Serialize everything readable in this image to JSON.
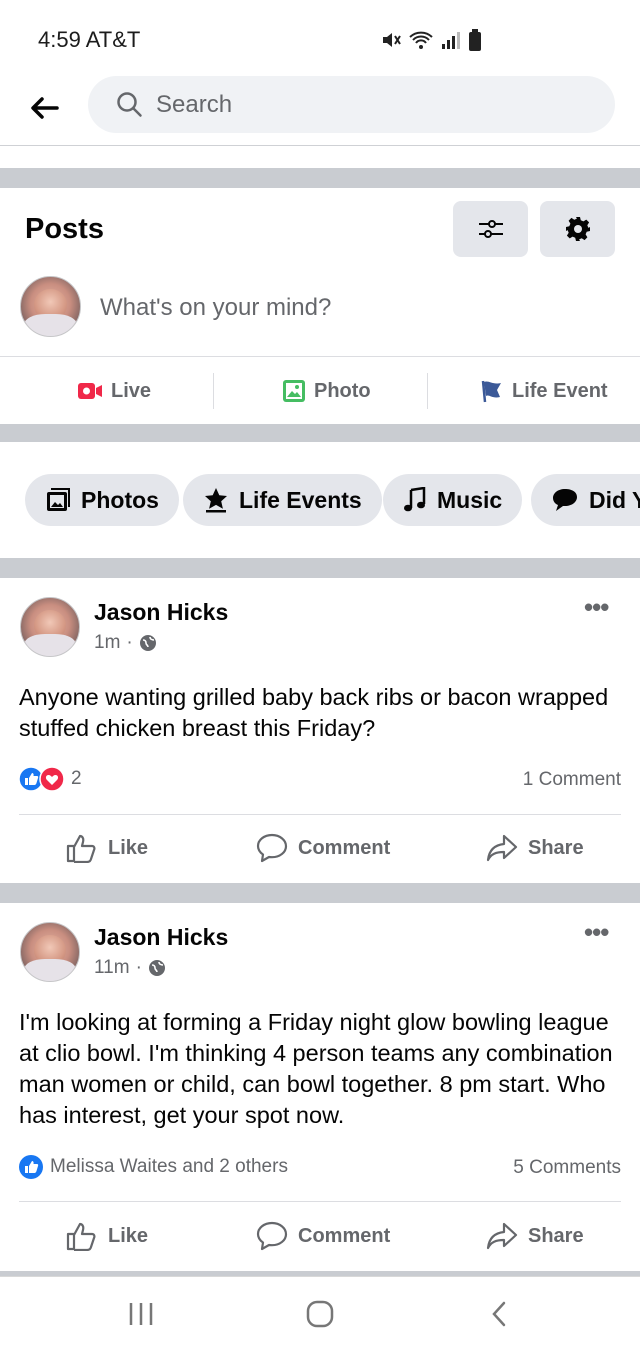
{
  "status": {
    "time": "4:59",
    "carrier": "AT&T"
  },
  "search": {
    "placeholder": "Search"
  },
  "header": {
    "title": "Posts",
    "composer_placeholder": "What's on your mind?"
  },
  "composer_actions": [
    {
      "label": "Live"
    },
    {
      "label": "Photo"
    },
    {
      "label": "Life Event"
    }
  ],
  "chips": [
    {
      "label": "Photos"
    },
    {
      "label": "Life Events"
    },
    {
      "label": "Music"
    },
    {
      "label": "Did Y"
    }
  ],
  "posts": [
    {
      "author": "Jason Hicks",
      "time": "1m",
      "text": "Anyone wanting grilled baby back ribs or bacon wrapped stuffed chicken breast this Friday?",
      "reactions": "2",
      "comments": "1 Comment",
      "like_label": "Like",
      "comment_label": "Comment",
      "share_label": "Share"
    },
    {
      "author": "Jason Hicks",
      "time": "11m",
      "text": "I'm looking at forming a Friday night glow bowling league at clio bowl. I'm thinking 4 person teams any combination man women or child, can bowl together. 8 pm start. Who has interest, get your spot now.",
      "reactions": "Melissa Waites and 2 others",
      "comments": "5 Comments",
      "like_label": "Like",
      "comment_label": "Comment",
      "share_label": "Share"
    }
  ],
  "colors": {
    "fb_blue": "#1877f2",
    "live_red": "#f02849",
    "photo_green": "#45bd62",
    "flag_blue": "#3b5998"
  }
}
